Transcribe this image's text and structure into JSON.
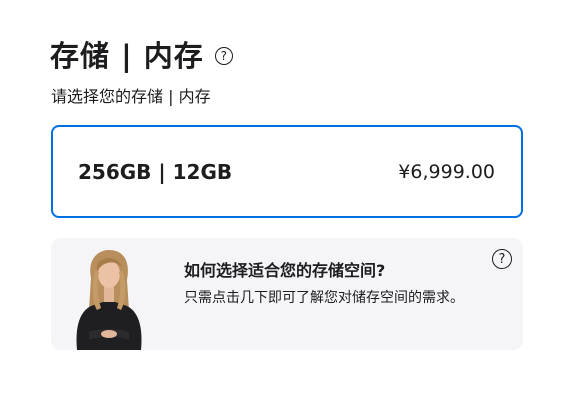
{
  "header": {
    "title": "存储 | 内存",
    "help_icon": "question-circle-icon",
    "subtitle": "请选择您的存储 | 内存"
  },
  "options": [
    {
      "label": "256GB | 12GB",
      "price": "¥6,999.00",
      "selected": true
    }
  ],
  "info_card": {
    "title": "如何选择适合您的存储空间?",
    "text": "只需点击几下即可了解您对储存空间的需求。",
    "help_icon": "question-circle-icon"
  },
  "colors": {
    "accent": "#0071e3",
    "card_background": "#f5f5f7",
    "text": "#1d1d1f"
  }
}
